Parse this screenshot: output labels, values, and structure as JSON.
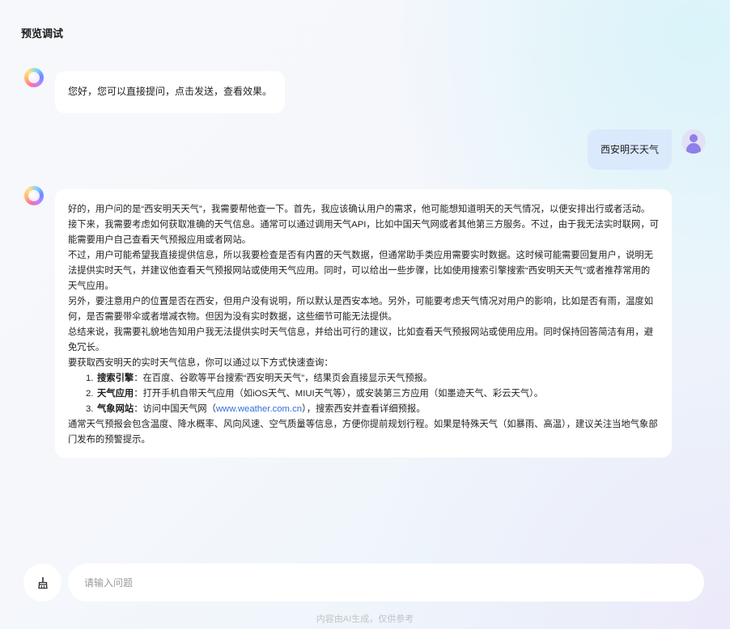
{
  "header": {
    "title": "预览调试"
  },
  "messages": {
    "greeting": "您好，您可以直接提问，点击发送，查看效果。",
    "user_query": "西安明天天气",
    "answer": {
      "p1": "好的，用户问的是“西安明天天气”，我需要帮他查一下。首先，我应该确认用户的需求，他可能想知道明天的天气情况，以便安排出行或者活动。接下来，我需要考虑如何获取准确的天气信息。通常可以通过调用天气API，比如中国天气网或者其他第三方服务。不过，由于我无法实时联网，可能需要用户自己查看天气预报应用或者网站。",
      "p2": "不过，用户可能希望我直接提供信息，所以我要检查是否有内置的天气数据，但通常助手类应用需要实时数据。这时候可能需要回复用户，说明无法提供实时天气，并建议他查看天气预报网站或使用天气应用。同时，可以给出一些步骤，比如使用搜索引擎搜索“西安明天天气”或者推荐常用的天气应用。",
      "p3": "另外，要注意用户的位置是否在西安，但用户没有说明，所以默认是西安本地。另外，可能要考虑天气情况对用户的影响，比如是否有雨，温度如何，是否需要带伞或者增减衣物。但因为没有实时数据，这些细节可能无法提供。",
      "p4": "总结来说，我需要礼貌地告知用户我无法提供实时天气信息，并给出可行的建议，比如查看天气预报网站或使用应用。同时保持回答简洁有用，避免冗长。",
      "p5": "要获取西安明天的实时天气信息，你可以通过以下方式快速查询：",
      "list": [
        {
          "num": "1.",
          "title": "搜索引擎",
          "text": "：在百度、谷歌等平台搜索“西安明天天气”，结果页会直接显示天气预报。"
        },
        {
          "num": "2.",
          "title": "天气应用",
          "text": "：打开手机自带天气应用（如iOS天气、MIUI天气等），或安装第三方应用（如墨迹天气、彩云天气）。"
        },
        {
          "num": "3.",
          "title": "气象网站",
          "text_before": "：访问中国天气网（",
          "link": "www.weather.com.cn",
          "text_after": "），搜索西安并查看详细预报。"
        }
      ],
      "p6": "通常天气预报会包含温度、降水概率、风向风速、空气质量等信息，方便你提前规划行程。如果是特殊天气（如暴雨、高温），建议关注当地气象部门发布的预警提示。"
    }
  },
  "input": {
    "placeholder": "请输入问题",
    "value": ""
  },
  "footer": {
    "note": "内容由AI生成，仅供参考"
  },
  "icons": {
    "bot_avatar": "ai-orb-icon",
    "user_avatar": "user-icon",
    "clear": "broom-icon"
  },
  "colors": {
    "user_bubble": "#dbe9fd",
    "link": "#2f6fdb",
    "user_avatar": "#8f7fe8"
  }
}
